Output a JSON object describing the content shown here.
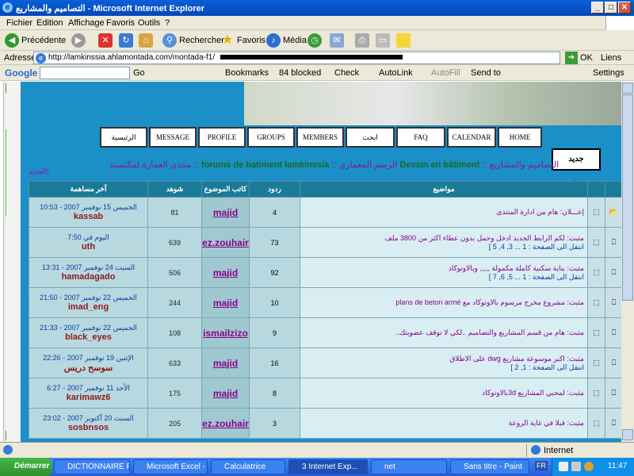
{
  "window": {
    "title": "التصاميم والمشاريع - Microsoft Internet Explorer"
  },
  "menu": [
    "Fichier",
    "Edition",
    "Affichage",
    "Favoris",
    "Outils",
    "?"
  ],
  "toolbar": {
    "back": "Précédente",
    "search": "Rechercher",
    "favorites": "Favoris",
    "media": "Média"
  },
  "address": {
    "label": "Adresse",
    "url": "http://lamkinssia.ahlamontada.com/montada-f1/",
    "go": "OK",
    "links": "Liens"
  },
  "google": {
    "label": "Google",
    "go": "Go",
    "bookmarks": "Bookmarks",
    "blocked": "84 blocked",
    "check": "Check",
    "autolink": "AutoLink",
    "autofill": "AutoFill",
    "sendto": "Send to",
    "settings": "Settings"
  },
  "nav": [
    "الرئيسية",
    "MESSAGE",
    "PROFILE",
    "GROUPS",
    "MEMBERS",
    "ابحث",
    "FAQ",
    "CALENDAR",
    "HOME"
  ],
  "breadcrumb": {
    "forum": "منتدى العمارة لمكنسية",
    "sep": "::",
    "site": "forums de batiment lamkinssia",
    "cat": "الرسم المعماري",
    "sub": "Dessin en bâtiment",
    "last": "التصاميم والمشاريع"
  },
  "new_topic_label": "جديد",
  "new_post_link": "الجديد!",
  "columns": {
    "topics": "مواضيع",
    "replies": "ردود",
    "author": "كاتب الموضوع",
    "views": "شوهد",
    "last": "آخر مساهمة"
  },
  "rows": [
    {
      "topic": "إعـــلان: هام من ادارة المنتدى",
      "pages": "",
      "replies": "4",
      "author": "majid",
      "views": "81",
      "last_date": "الخميس 15 نوفمبر 2007 - 10:53",
      "last_user": "kassab"
    },
    {
      "topic": "مثبت: لكم الرابط الجديد ادخل وحمل بدون عطاء اكثر من 3800 ملف",
      "pages": "انتقل الى الصفحة : 1 ... 3, 4, 5 ]",
      "replies": "73",
      "author": "ez.zouhair",
      "views": "639",
      "last_date": "اليوم في 7:50",
      "last_user": "uth"
    },
    {
      "topic": "مثبت: بناية سكنية كاملة مكمولة ,,,,, وبالاوتوكاد",
      "pages": "انتقل الى الصفحة : 1 ... 5, 6, 7 ]",
      "replies": "92",
      "author": "majid",
      "views": "506",
      "last_date": "السبت 24 نوفمبر 2007 - 13:31",
      "last_user": "hamadagado"
    },
    {
      "topic": "مثبت: مشروع مخرج مرسوم بالاوتوكاد مع plans de beton armé",
      "pages": "",
      "replies": "10",
      "author": "majid",
      "views": "244",
      "last_date": "الخميس 22 نوفمبر 2007 - 21:50",
      "last_user": "imad_eng"
    },
    {
      "topic": "مثبت: هام من قسم المشاريع والتصاميم ..لكي لا توقف عضويتك..",
      "pages": "",
      "replies": "9",
      "author": "ismailzizo",
      "views": "108",
      "last_date": "الخميس 22 نوفمبر 2007 - 21:33",
      "last_user": "black_eyes"
    },
    {
      "topic": "مثبت: اكبر موسوعة مشاريع dwg على الاطلاق",
      "pages": "انتقل الى الصفحة : 1, 2 ]",
      "replies": "16",
      "author": "majid",
      "views": "633",
      "last_date": "الإثنين 19 نوفمبر 2007 - 22:26",
      "last_user": "سوسح دريس"
    },
    {
      "topic": "مثبت: لمحبي المشاريع 3dبالاوتوكاد",
      "pages": "",
      "replies": "8",
      "author": "majid",
      "views": "175",
      "last_date": "الأحد 11 نوفمبر 2007 - 6:27",
      "last_user": "karimawz6"
    },
    {
      "topic": "مثبت: فيلا في غاية الروعة",
      "pages": "",
      "replies": "3",
      "author": "ez.zouhair",
      "views": "205",
      "last_date": "السبت 20 أكتوبر 2007 - 23:02",
      "last_user": "sosbnsos"
    }
  ],
  "status": {
    "zone": "Internet"
  },
  "taskbar": {
    "start": "Démarrer",
    "items": [
      "DICTIONNAIRE F...",
      "Microsoft Excel - ...",
      "Calculatrice",
      "3 Internet Exp...",
      "net",
      "Sans titre - Paint"
    ],
    "lang": "FR",
    "clock": "11:47"
  }
}
